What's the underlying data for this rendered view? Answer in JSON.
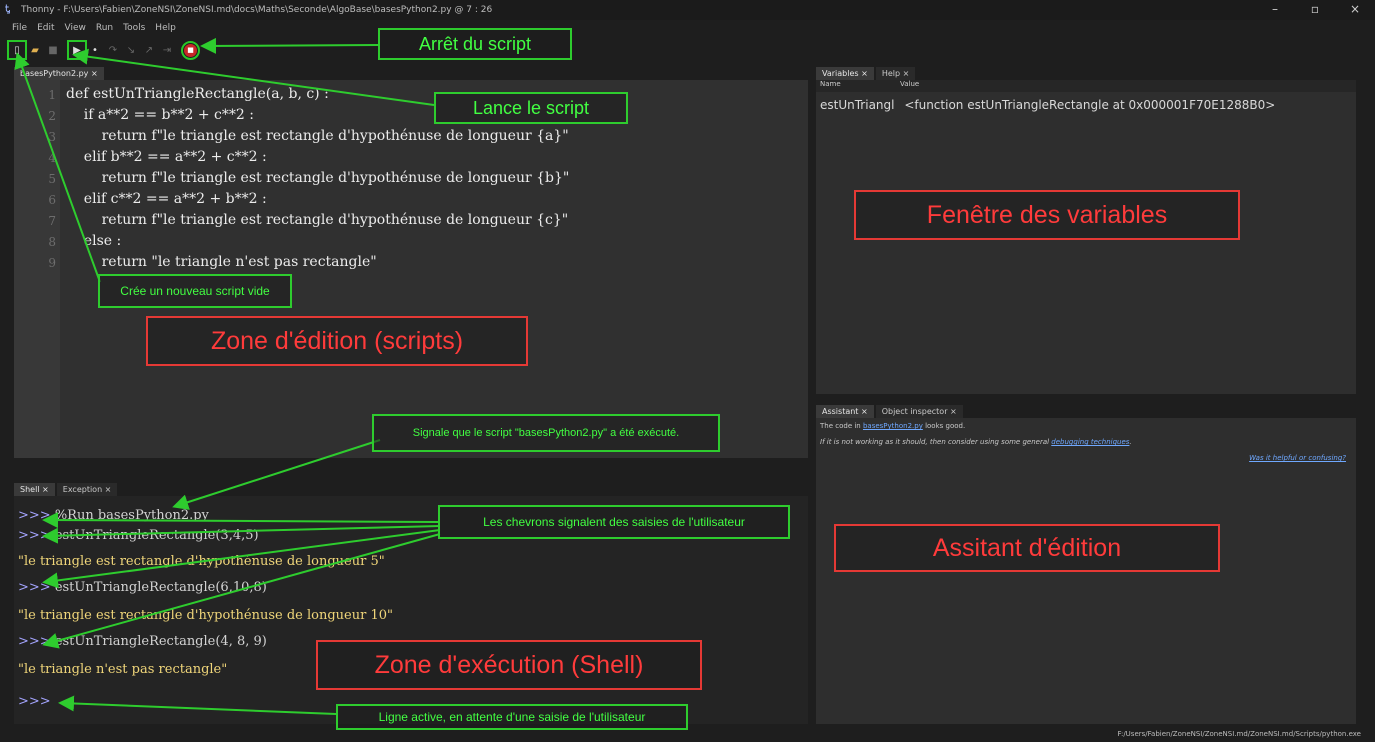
{
  "window": {
    "title": "Thonny  -  F:\\Users\\Fabien\\ZoneNSI\\ZoneNSI.md\\docs\\Maths\\Seconde\\AlgoBase\\basesPython2.py  @  7 : 26",
    "controls": [
      "–",
      "▫",
      "×"
    ]
  },
  "menu": [
    "File",
    "Edit",
    "View",
    "Run",
    "Tools",
    "Help"
  ],
  "editor": {
    "tab": "basesPython2.py ×",
    "lines": [
      {
        "n": "1",
        "code": "def estUnTriangleRectangle(a, b, c) :"
      },
      {
        "n": "2",
        "code": "    if a**2 == b**2 + c**2 :"
      },
      {
        "n": "3",
        "code": "        return f\"le triangle est rectangle d'hypothénuse de longueur {a}\""
      },
      {
        "n": "4",
        "code": "    elif b**2 == a**2 + c**2 :"
      },
      {
        "n": "5",
        "code": "        return f\"le triangle est rectangle d'hypothénuse de longueur {b}\""
      },
      {
        "n": "6",
        "code": "    elif c**2 == a**2 + b**2 :"
      },
      {
        "n": "7",
        "code": "        return f\"le triangle est rectangle d'hypothénuse de longueur {c}\""
      },
      {
        "n": "8",
        "code": "    else :"
      },
      {
        "n": "9",
        "code": "        return \"le triangle n'est pas rectangle\""
      }
    ]
  },
  "shell": {
    "tabs": [
      "Shell ×",
      "Exception ×"
    ],
    "lines": [
      {
        "kind": "cmd",
        "prompt": ">>>",
        "text": " %Run basesPython2.py"
      },
      {
        "kind": "cmd",
        "prompt": ">>>",
        "text": " estUnTriangleRectangle(3,4,5)"
      },
      {
        "kind": "out",
        "prompt": "",
        "text": "\"le triangle est rectangle d'hypothénuse de longueur 5\""
      },
      {
        "kind": "cmd",
        "prompt": ">>>",
        "text": " estUnTriangleRectangle(6,10,8)"
      },
      {
        "kind": "out",
        "prompt": "",
        "text": "\"le triangle est rectangle d'hypothénuse de longueur 10\""
      },
      {
        "kind": "cmd",
        "prompt": ">>>",
        "text": " estUnTriangleRectangle(4, 8, 9)"
      },
      {
        "kind": "out",
        "prompt": "",
        "text": "\"le triangle n'est pas rectangle\""
      },
      {
        "kind": "cmd",
        "prompt": ">>>",
        "text": ""
      }
    ]
  },
  "variables": {
    "tabs": [
      "Variables ×",
      "Help ×"
    ],
    "head": [
      "Name",
      "Value"
    ],
    "row_name": "estUnTriangl",
    "row_value": "<function estUnTriangleRectangle at 0x000001F70E1288B0>"
  },
  "assistant": {
    "tabs": [
      "Assistant ×",
      "Object inspector ×"
    ],
    "line1_pre": "The code in ",
    "line1_link": "basesPython2.py",
    "line1_post": " looks good.",
    "line2_pre": "If it is not working as it should, then consider using some general ",
    "line2_link": "debugging techniques",
    "line2_post": ".",
    "feedback": "Was it helpful or confusing?"
  },
  "status": "F:/Users/Fabien/ZoneNSI/ZoneNSI.md/ZoneNSI.md/Scripts/python.exe",
  "annotations": {
    "stop": "Arrêt du script",
    "run": "Lance le script",
    "newscript": "Crée un nouveau script vide",
    "edit_zone": "Zone d'édition (scripts)",
    "var_window": "Fenêtre des variables",
    "executed": "Signale que le script \"basesPython2.py\" a été exécuté.",
    "chevrons": "Les chevrons signalent des saisies de l'utilisateur",
    "assistant": "Assitant d'édition",
    "shell_zone": "Zone d'exécution (Shell)",
    "active_line": "Ligne active, en attente d'une saisie de l'utilisateur"
  }
}
